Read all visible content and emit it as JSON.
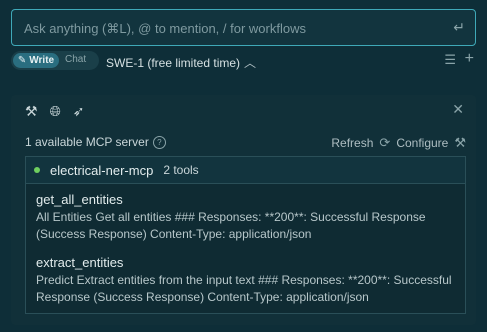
{
  "input": {
    "placeholder": "Ask anything (⌘L), @ to mention, / for workflows",
    "enter_glyph": "↵"
  },
  "mode": {
    "write_label": "Write",
    "chat_label": "Chat",
    "model_label": "SWE-1 (free limited time)"
  },
  "panel": {
    "server_count_label": "1 available MCP server",
    "refresh_label": "Refresh",
    "configure_label": "Configure",
    "server": {
      "name": "electrical-ner-mcp",
      "tool_count": "2 tools",
      "status_color": "#6fcf5f",
      "tools": [
        {
          "name": "get_all_entities",
          "description": "All Entities Get all entities ### Responses: **200**: Successful Response (Success Response) Content-Type: application/json"
        },
        {
          "name": "extract_entities",
          "description": "Predict Extract entities from the input text ### Responses: **200**: Successful Response (Success Response) Content-Type: application/json"
        }
      ]
    }
  },
  "colors": {
    "accent": "#3fa9b8",
    "background": "#0e2e38",
    "write_active": "#2a6e80"
  }
}
